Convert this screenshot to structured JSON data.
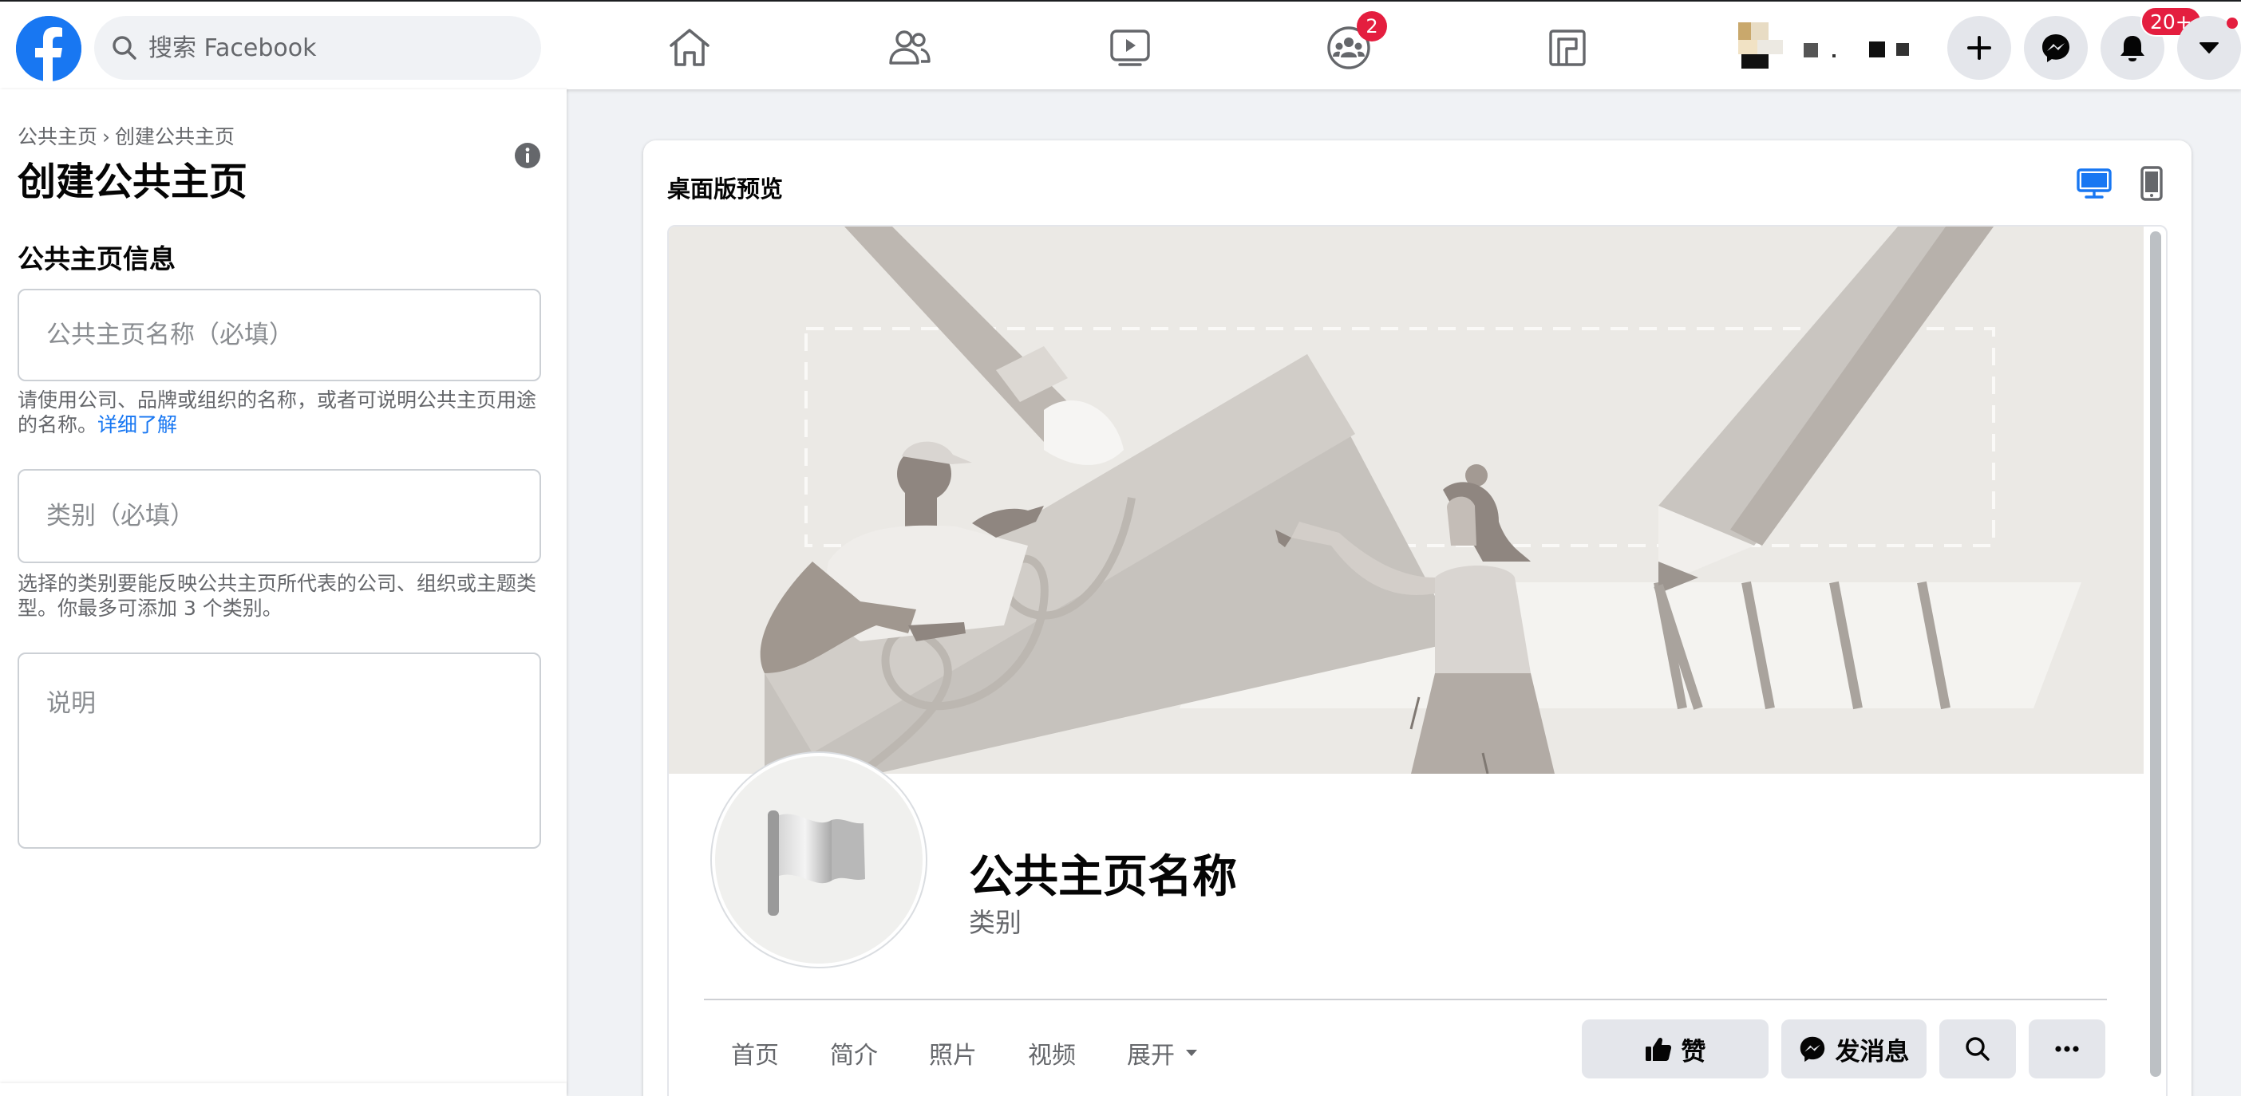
{
  "search": {
    "placeholder": "搜索 Facebook"
  },
  "nav": {
    "items": [
      {
        "name": "home-icon"
      },
      {
        "name": "friends-icon"
      },
      {
        "name": "watch-icon"
      },
      {
        "name": "groups-icon",
        "badge": "2"
      },
      {
        "name": "gaming-icon"
      }
    ]
  },
  "header_actions": {
    "create": "plus-icon",
    "messenger": "messenger-icon",
    "notifications_badge": "20+",
    "account": "caret-down-icon"
  },
  "left_panel": {
    "breadcrumb": [
      "公共主页",
      "创建公共主页"
    ],
    "breadcrumb_sep": "›",
    "title": "创建公共主页",
    "section_title": "公共主页信息",
    "name_placeholder": "公共主页名称（必填）",
    "name_help": "请使用公司、品牌或组织的名称，或者可说明公共主页用途的名称。",
    "learn_more": "详细了解",
    "category_placeholder": "类别（必填）",
    "category_help": "选择的类别要能反映公共主页所代表的公司、组织或主题类型。你最多可添加 3 个类别。",
    "description_placeholder": "说明"
  },
  "preview": {
    "title": "桌面版预览",
    "page_name": "公共主页名称",
    "category": "类别",
    "tabs": [
      "首页",
      "简介",
      "照片",
      "视频",
      "展开"
    ],
    "like_label": "赞",
    "message_label": "发消息"
  },
  "colors": {
    "brand": "#1877f2",
    "badge": "#e41e3f",
    "page_bg": "#f0f2f5",
    "button_bg": "#e4e6eb"
  }
}
